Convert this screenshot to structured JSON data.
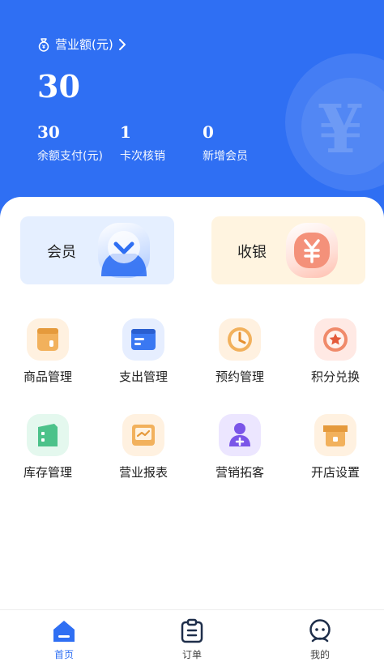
{
  "header": {
    "revenue_label": "营业额(元)",
    "revenue_value": "30",
    "stats": [
      {
        "value": "30",
        "label": "余额支付(元)"
      },
      {
        "value": "1",
        "label": "卡次核销"
      },
      {
        "value": "0",
        "label": "新增会员"
      }
    ],
    "icons": {
      "revenue": "money-bag-icon",
      "chevron": "chevron-right-icon"
    },
    "background_color": "#2f6ff3"
  },
  "quick_actions": [
    {
      "label": "会员",
      "icon": "member-icon",
      "color": "#2f6ff3"
    },
    {
      "label": "收银",
      "icon": "yen-icon",
      "color": "#f07a5a"
    }
  ],
  "grid": [
    {
      "label": "商品管理",
      "icon": "product-icon"
    },
    {
      "label": "支出管理",
      "icon": "expense-icon"
    },
    {
      "label": "预约管理",
      "icon": "clock-icon"
    },
    {
      "label": "积分兑换",
      "icon": "star-medal-icon"
    },
    {
      "label": "库存管理",
      "icon": "inventory-icon"
    },
    {
      "label": "营业报表",
      "icon": "report-icon"
    },
    {
      "label": "营销拓客",
      "icon": "marketing-user-icon"
    },
    {
      "label": "开店设置",
      "icon": "store-icon"
    }
  ],
  "tabbar": {
    "tabs": [
      {
        "label": "首页",
        "icon": "home-icon",
        "active": true
      },
      {
        "label": "订单",
        "icon": "order-icon",
        "active": false
      },
      {
        "label": "我的",
        "icon": "profile-icon",
        "active": false
      }
    ],
    "active_color": "#2f6ff3"
  }
}
